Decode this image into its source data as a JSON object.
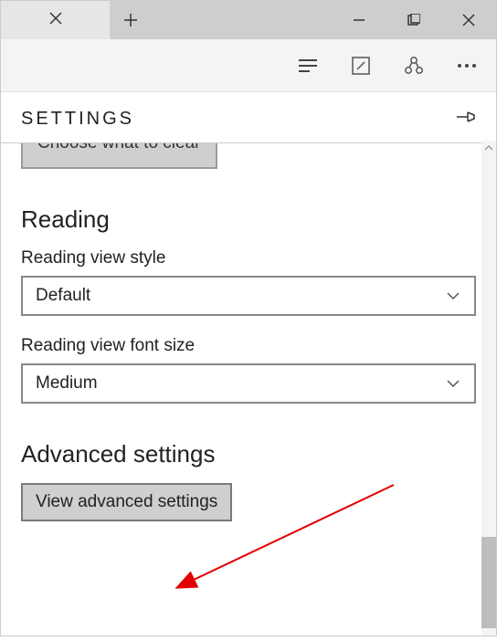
{
  "panel": {
    "title": "SETTINGS"
  },
  "clip_button_label": "Choose what to clear",
  "reading": {
    "heading": "Reading",
    "style_label": "Reading view style",
    "style_value": "Default",
    "fontsize_label": "Reading view font size",
    "fontsize_value": "Medium"
  },
  "advanced": {
    "heading": "Advanced settings",
    "button_label": "View advanced settings"
  }
}
